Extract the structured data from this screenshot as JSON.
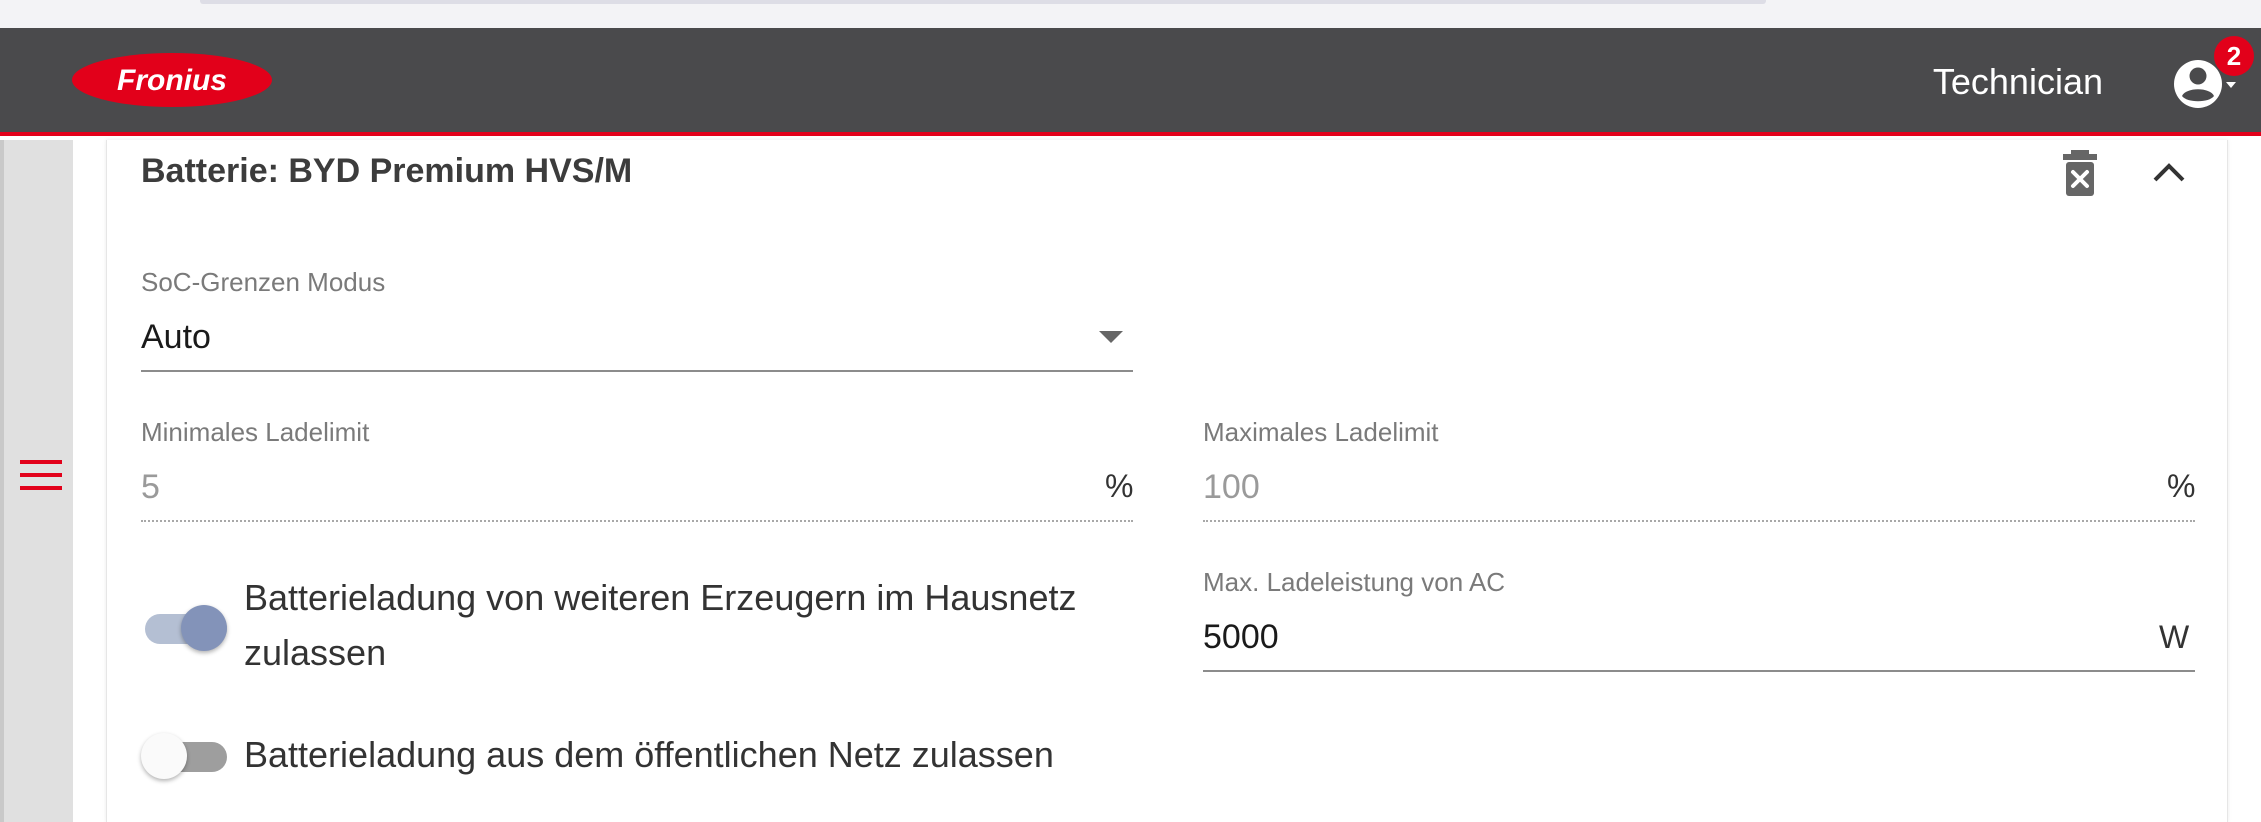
{
  "header": {
    "logo_text": "Fronius",
    "user_label": "Technician",
    "notification_count": "2",
    "brand_color": "#e2001a"
  },
  "battery_panel": {
    "title": "Batterie: BYD Premium HVS/M",
    "delete_icon": "trash-x-icon",
    "collapse_icon": "chevron-up-icon",
    "soc_mode": {
      "label": "SoC-Grenzen Modus",
      "value": "Auto"
    },
    "min_charge_limit": {
      "label": "Minimales Ladelimit",
      "value": "5",
      "unit": "%"
    },
    "max_charge_limit": {
      "label": "Maximales Ladelimit",
      "value": "100",
      "unit": "%"
    },
    "charge_from_other_producers": {
      "label_line1": "Batterieladung von weiteren Erzeugern im Hausnetz",
      "label_line2": "zulassen",
      "enabled": true
    },
    "max_ac_charge_power": {
      "label": "Max. Ladeleistung von AC",
      "value": "5000",
      "unit": "W"
    },
    "charge_from_public_grid": {
      "label": "Batterieladung aus dem öffentlichen Netz zulassen",
      "enabled": false
    }
  }
}
